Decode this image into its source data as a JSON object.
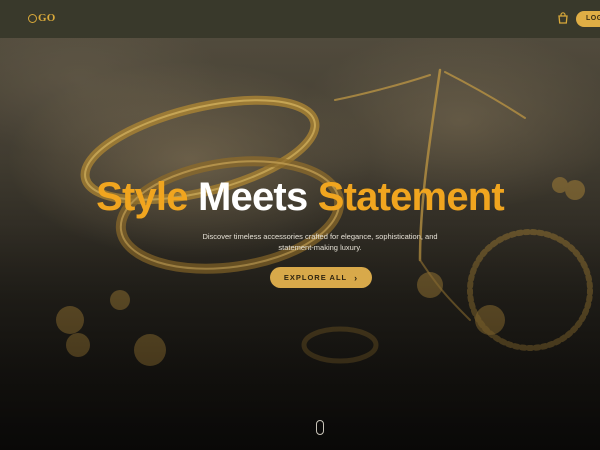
{
  "header": {
    "logo_text": "GO",
    "cart_icon": "shopping-bag-icon",
    "login_label": "LOG"
  },
  "hero": {
    "title_word_1": "Style",
    "title_word_2": "Meets",
    "title_word_3": "Statement",
    "subtitle_line_1": "Discover timeless accessories crafted for elegance, sophistication, and",
    "subtitle_line_2": "statement-making luxury.",
    "cta_label": "EXPLORE ALL",
    "cta_icon": "chevron-right-icon"
  },
  "colors": {
    "header_bg": "#39392b",
    "accent_gold": "#f0a51f",
    "button_gold": "#d8a94a"
  }
}
